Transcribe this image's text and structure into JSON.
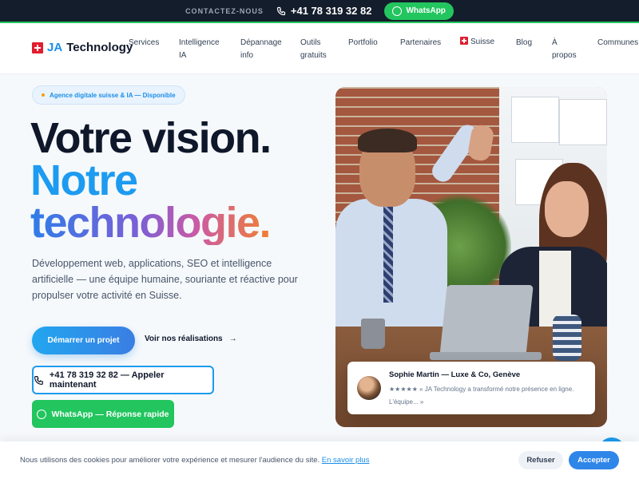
{
  "topbar": {
    "contact_label": "CONTACTEZ-NOUS",
    "phone": "+41 78 319 32 82",
    "whatsapp_label": "WhatsApp"
  },
  "nav": {
    "logo_ja": "JA",
    "logo_tech": "Technology",
    "items": [
      {
        "line1": "Services",
        "line2": ""
      },
      {
        "line1": "Intelligence",
        "line2": "IA"
      },
      {
        "line1": "Dépannage",
        "line2": "info"
      },
      {
        "line1": "Outils",
        "line2": "gratuits"
      },
      {
        "line1": "Portfolio",
        "line2": ""
      },
      {
        "line1": "Partenaires",
        "line2": ""
      },
      {
        "line1": "Suisse",
        "line2": ""
      },
      {
        "line1": "Blog",
        "line2": ""
      },
      {
        "line1": "À",
        "line2": "propos"
      },
      {
        "line1": "Communes",
        "line2": ""
      }
    ]
  },
  "hero": {
    "badge": "Agence digitale suisse & IA — Disponible",
    "title_line1": "Votre vision.",
    "title_line2": "Notre",
    "title_line3": "technologie.",
    "lead": "Développement web, applications, SEO et intelligence artificielle — une équipe humaine, souriante et réactive pour propulser votre activité en Suisse.",
    "cta_primary": "Démarrer un projet",
    "cta_secondary": "Voir nos réalisations",
    "cta_secondary_arrow": "→",
    "call_label": "+41 78 319 32 82 — Appeler maintenant",
    "whatsapp_label": "WhatsApp — Réponse rapide"
  },
  "testimonial": {
    "name": "Sophie Martin — Luxe & Co, Genève",
    "quote": "★★★★★ « JA Technology a transformé notre présence en ligne. L'équipe... »"
  },
  "cookie": {
    "text": "Nous utilisons des cookies pour améliorer votre expérience et mesurer l'audience du site.",
    "link": "En savoir plus",
    "refuse": "Refuser",
    "accept": "Accepter"
  },
  "colors": {
    "accent_blue": "#1d9bf0",
    "whatsapp_green": "#22c55e",
    "topbar_dark": "#141d2b"
  }
}
